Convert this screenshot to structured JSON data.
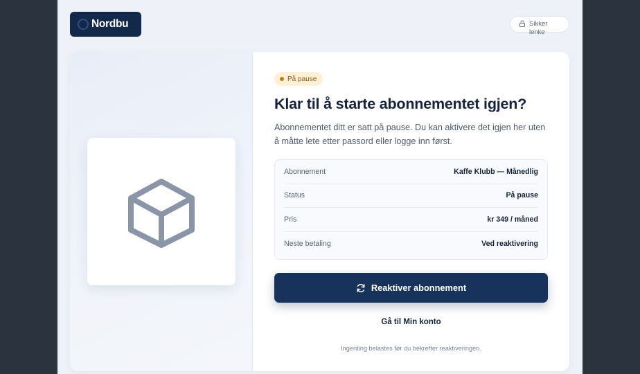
{
  "header": {
    "brand": "Nordbu",
    "secure_label": "Sikker lenke"
  },
  "status_badge": "På pause",
  "title": "Klar til å starte abonnementet igjen?",
  "description": "Abonnementet ditt er satt på pause. Du kan aktivere det igjen her uten å måtte lete etter passord eller logge inn først.",
  "details": [
    {
      "label": "Abonnement",
      "value": "Kaffe Klubb — Månedlig"
    },
    {
      "label": "Status",
      "value": "På pause"
    },
    {
      "label": "Pris",
      "value": "kr 349 / måned"
    },
    {
      "label": "Neste betaling",
      "value": "Ved reaktivering"
    }
  ],
  "primary_button": "Reaktiver abonnement",
  "account_link": "Gå til Min konto",
  "footnote": "Ingenting belastes før du bekrefter reaktiveringen.",
  "colors": {
    "brand": "#13294b",
    "primary": "#17335c",
    "badge_bg": "#fdf0d6",
    "badge_dot": "#c27c10"
  },
  "icons": {
    "brand": "circle-logo-icon",
    "secure": "lock-icon",
    "product": "box-icon",
    "button": "refresh-icon"
  }
}
